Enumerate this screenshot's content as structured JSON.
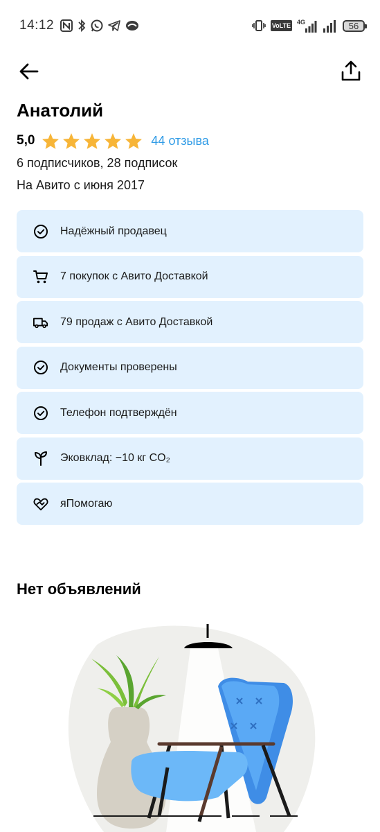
{
  "status_bar": {
    "time": "14:12",
    "network_type": "4G",
    "volte_label": "VoLTE",
    "battery_level": "56"
  },
  "nav": {
    "back_icon": "arrow-left-icon",
    "share_icon": "share-icon"
  },
  "profile": {
    "name": "Анатолий",
    "rating": "5,0",
    "stars_filled": 5,
    "stars_total": 5,
    "reviews_text": "44 отзыва",
    "followers_text": "6 подписчиков, 28 подписок",
    "since_text": "На Авито с июня 2017"
  },
  "badges": [
    {
      "icon": "check-circle-icon",
      "label": "Надёжный продавец"
    },
    {
      "icon": "cart-icon",
      "label": "7 покупок с Авито Доставкой"
    },
    {
      "icon": "truck-icon",
      "label": "79 продаж с Авито Доставкой"
    },
    {
      "icon": "check-circle-icon",
      "label": "Документы проверены"
    },
    {
      "icon": "check-circle-icon",
      "label": "Телефон подтверждён"
    },
    {
      "icon": "sprout-icon",
      "label": "Эковклад: −10 кг CO₂"
    },
    {
      "icon": "heart-hands-icon",
      "label": "яПомогаю"
    }
  ],
  "listings": {
    "empty_title": "Нет объявлений"
  },
  "colors": {
    "accent_link": "#2f9be6",
    "star": "#f7b538",
    "badge_bg": "#e2f1fe",
    "chair_blue": "#5aa9f5"
  }
}
